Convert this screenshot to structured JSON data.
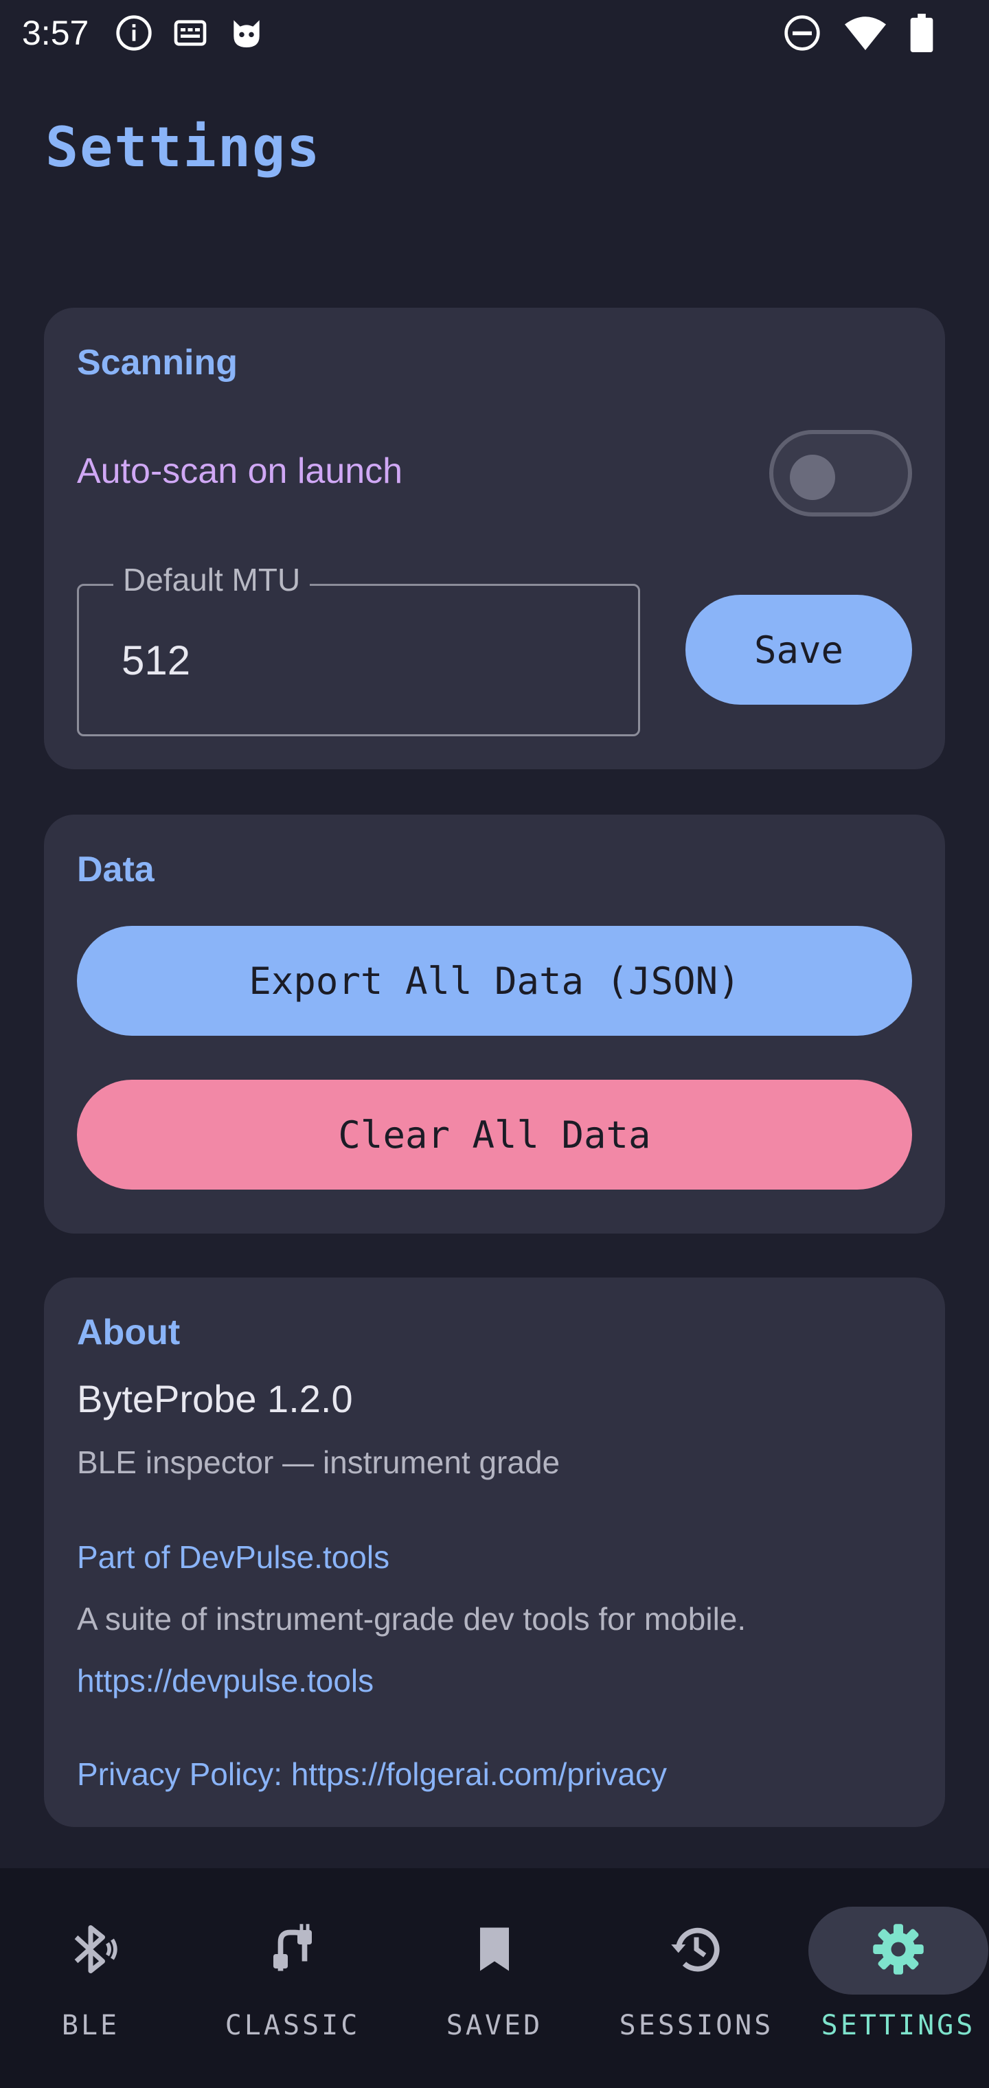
{
  "status_bar": {
    "time": "3:57",
    "left_icons": [
      "info-icon",
      "keyboard-icon",
      "cat-face-icon"
    ],
    "right_icons": [
      "do-not-disturb-icon",
      "wifi-icon",
      "battery-icon"
    ]
  },
  "page": {
    "title": "Settings"
  },
  "scanning": {
    "title": "Scanning",
    "auto_scan_label": "Auto-scan on launch",
    "auto_scan_enabled": false,
    "mtu_label": "Default MTU",
    "mtu_value": "512",
    "save_label": "Save"
  },
  "data_section": {
    "title": "Data",
    "export_label": "Export All Data (JSON)",
    "clear_label": "Clear All Data"
  },
  "about": {
    "title": "About",
    "app_name": "ByteProbe 1.2.0",
    "tagline": "BLE inspector — instrument grade",
    "suite_link": "Part of DevPulse.tools",
    "suite_desc": "A suite of instrument-grade dev tools for mobile.",
    "suite_url": "https://devpulse.tools",
    "privacy": "Privacy Policy: https://folgerai.com/privacy"
  },
  "nav": {
    "items": [
      {
        "label": "BLE",
        "icon": "bluetooth-icon",
        "active": false
      },
      {
        "label": "CLASSIC",
        "icon": "cable-icon",
        "active": false
      },
      {
        "label": "SAVED",
        "icon": "bookmark-icon",
        "active": false
      },
      {
        "label": "SESSIONS",
        "icon": "history-icon",
        "active": false
      },
      {
        "label": "SETTINGS",
        "icon": "gear-icon",
        "active": true
      }
    ]
  },
  "colors": {
    "background": "#1e1f2d",
    "card": "#303142",
    "accent_blue": "#8ab4f8",
    "accent_purple": "#d0a8f5",
    "danger_pink": "#f288a6",
    "active_teal": "#7ee3cc"
  }
}
